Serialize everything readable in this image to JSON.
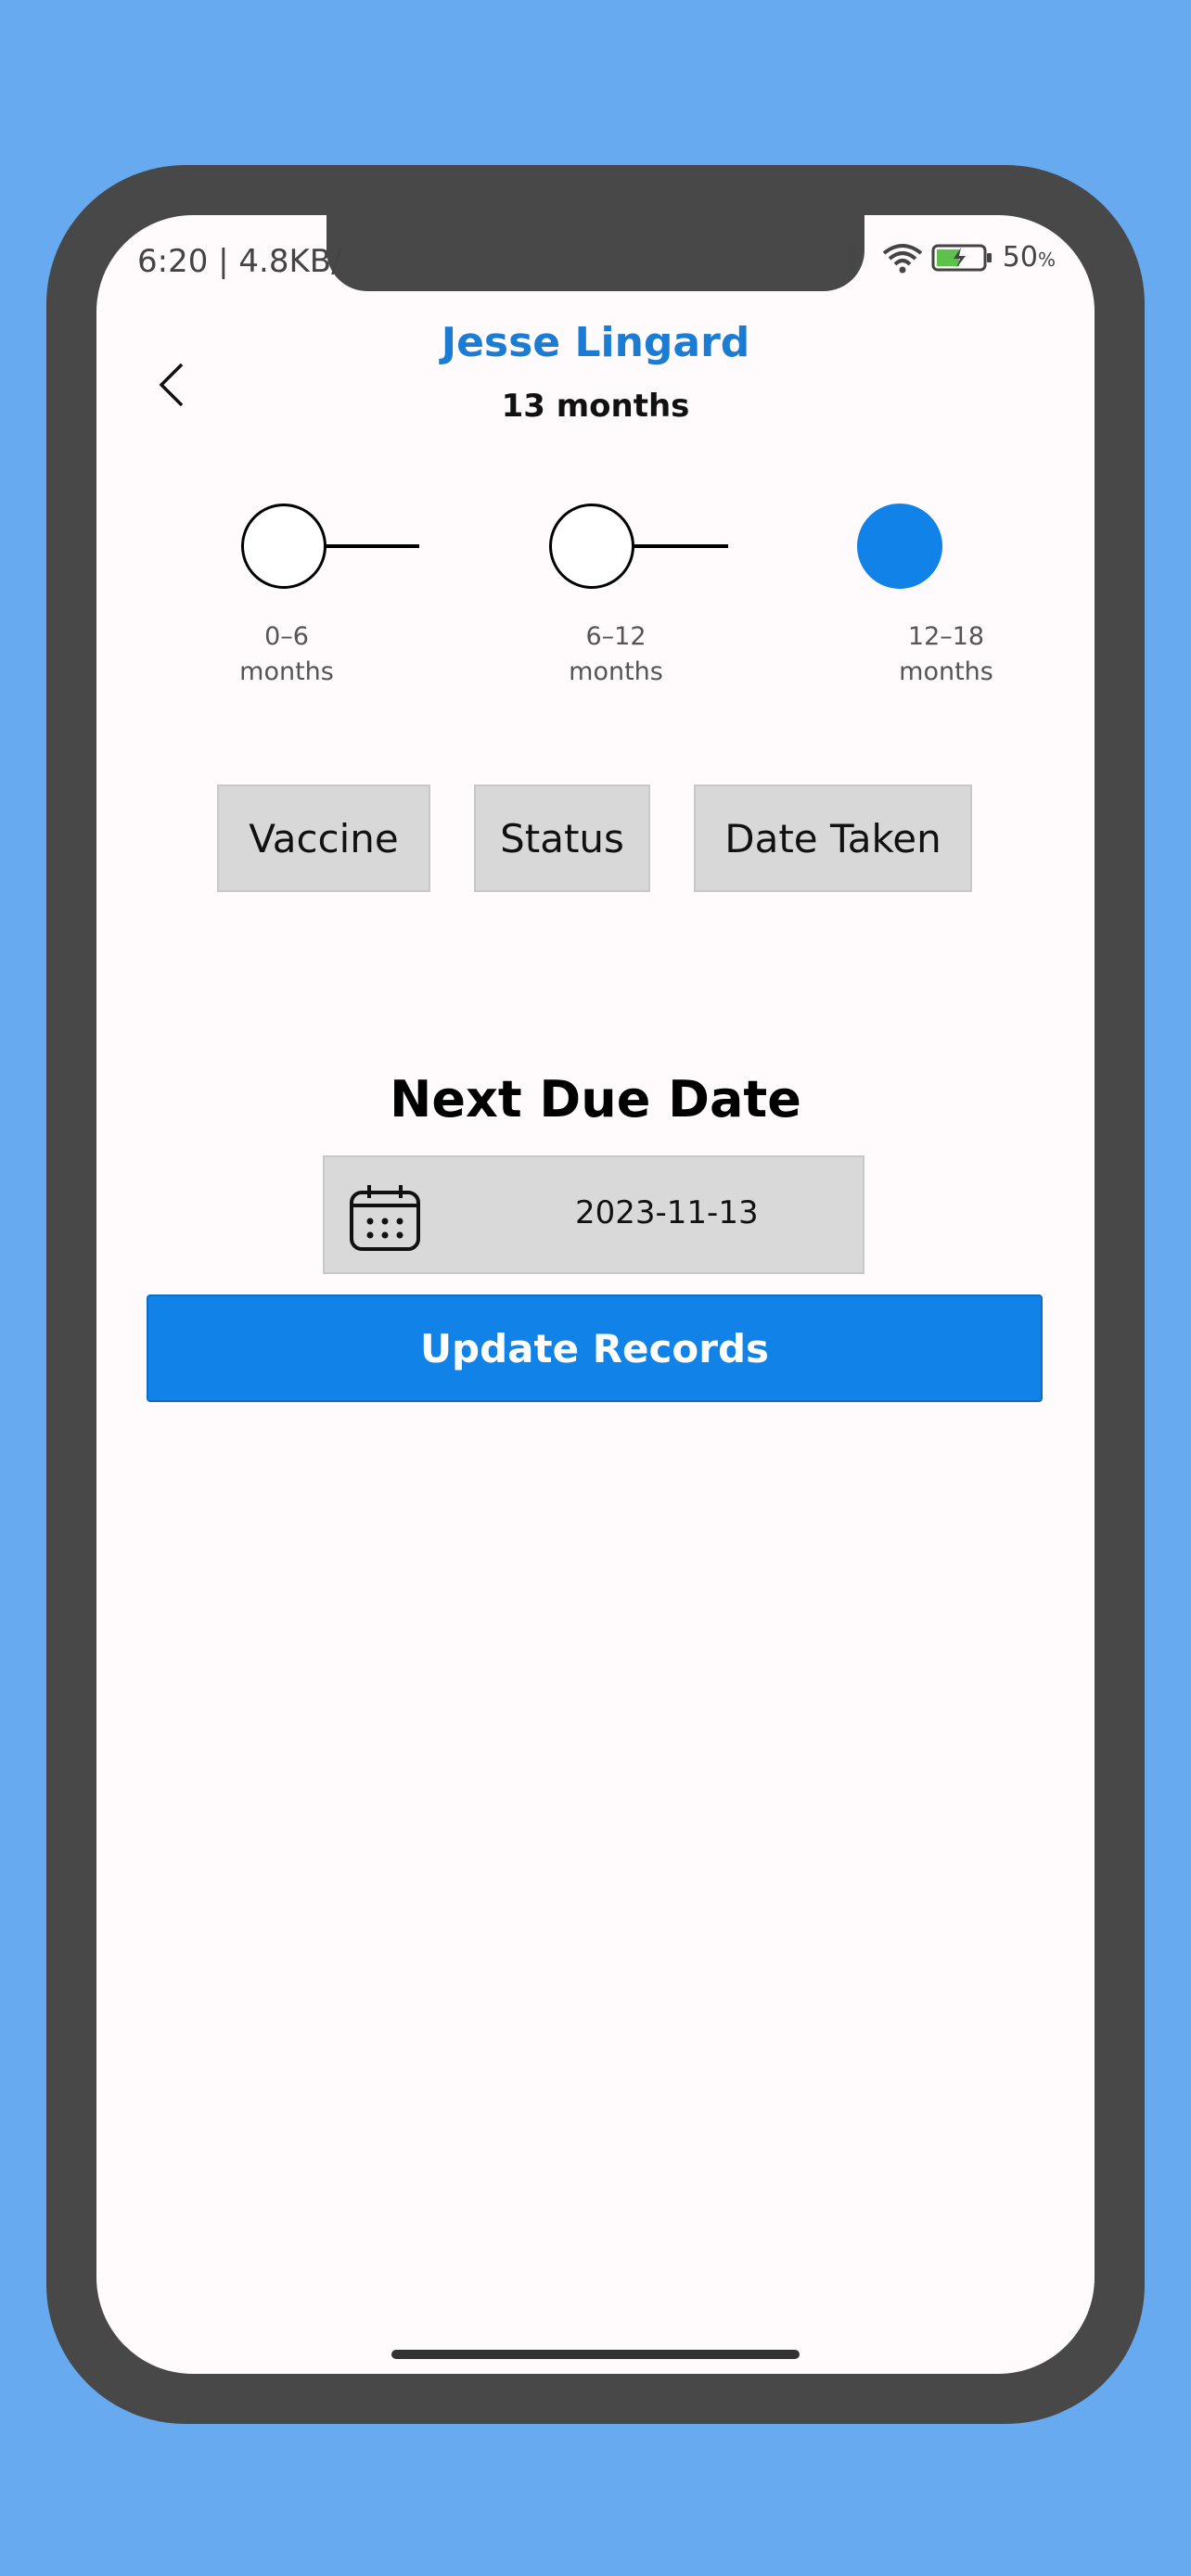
{
  "status_bar": {
    "time_network": "6:20 | 4.8KB/",
    "battery": "50",
    "battery_unit": "%"
  },
  "header": {
    "back_icon": "chevron-left-icon",
    "child_name": "Jesse Lingard",
    "age": "13 months"
  },
  "stepper": {
    "steps": [
      {
        "range": "0–6",
        "unit": "months",
        "active": false
      },
      {
        "range": "6–12",
        "unit": "months",
        "active": false
      },
      {
        "range": "12–18",
        "unit": "months",
        "active": true
      }
    ]
  },
  "table": {
    "columns": [
      "Vaccine",
      "Status",
      "Date Taken"
    ]
  },
  "next_due": {
    "title": "Next Due Date",
    "date": "2023-11-13",
    "icon": "calendar-icon"
  },
  "actions": {
    "update_label": "Update Records"
  },
  "colors": {
    "background": "#67aaf0",
    "accent": "#1182e8",
    "name": "#1b7cd3",
    "header_cell": "#d8d8d8"
  }
}
